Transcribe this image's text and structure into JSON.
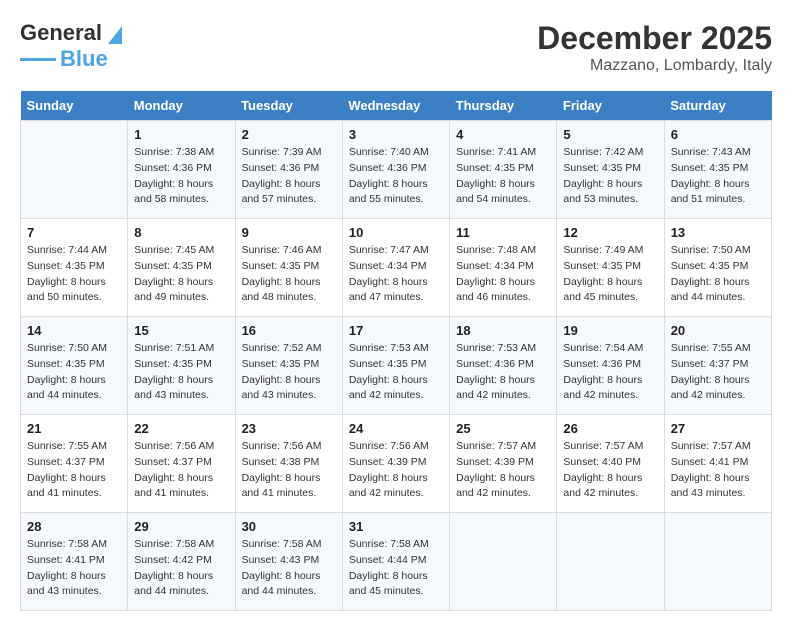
{
  "header": {
    "logo_line1": "General",
    "logo_line2": "Blue",
    "month": "December 2025",
    "location": "Mazzano, Lombardy, Italy"
  },
  "days_of_week": [
    "Sunday",
    "Monday",
    "Tuesday",
    "Wednesday",
    "Thursday",
    "Friday",
    "Saturday"
  ],
  "weeks": [
    [
      {
        "day": "",
        "sunrise": "",
        "sunset": "",
        "daylight": ""
      },
      {
        "day": "1",
        "sunrise": "Sunrise: 7:38 AM",
        "sunset": "Sunset: 4:36 PM",
        "daylight": "Daylight: 8 hours and 58 minutes."
      },
      {
        "day": "2",
        "sunrise": "Sunrise: 7:39 AM",
        "sunset": "Sunset: 4:36 PM",
        "daylight": "Daylight: 8 hours and 57 minutes."
      },
      {
        "day": "3",
        "sunrise": "Sunrise: 7:40 AM",
        "sunset": "Sunset: 4:36 PM",
        "daylight": "Daylight: 8 hours and 55 minutes."
      },
      {
        "day": "4",
        "sunrise": "Sunrise: 7:41 AM",
        "sunset": "Sunset: 4:35 PM",
        "daylight": "Daylight: 8 hours and 54 minutes."
      },
      {
        "day": "5",
        "sunrise": "Sunrise: 7:42 AM",
        "sunset": "Sunset: 4:35 PM",
        "daylight": "Daylight: 8 hours and 53 minutes."
      },
      {
        "day": "6",
        "sunrise": "Sunrise: 7:43 AM",
        "sunset": "Sunset: 4:35 PM",
        "daylight": "Daylight: 8 hours and 51 minutes."
      }
    ],
    [
      {
        "day": "7",
        "sunrise": "Sunrise: 7:44 AM",
        "sunset": "Sunset: 4:35 PM",
        "daylight": "Daylight: 8 hours and 50 minutes."
      },
      {
        "day": "8",
        "sunrise": "Sunrise: 7:45 AM",
        "sunset": "Sunset: 4:35 PM",
        "daylight": "Daylight: 8 hours and 49 minutes."
      },
      {
        "day": "9",
        "sunrise": "Sunrise: 7:46 AM",
        "sunset": "Sunset: 4:35 PM",
        "daylight": "Daylight: 8 hours and 48 minutes."
      },
      {
        "day": "10",
        "sunrise": "Sunrise: 7:47 AM",
        "sunset": "Sunset: 4:34 PM",
        "daylight": "Daylight: 8 hours and 47 minutes."
      },
      {
        "day": "11",
        "sunrise": "Sunrise: 7:48 AM",
        "sunset": "Sunset: 4:34 PM",
        "daylight": "Daylight: 8 hours and 46 minutes."
      },
      {
        "day": "12",
        "sunrise": "Sunrise: 7:49 AM",
        "sunset": "Sunset: 4:35 PM",
        "daylight": "Daylight: 8 hours and 45 minutes."
      },
      {
        "day": "13",
        "sunrise": "Sunrise: 7:50 AM",
        "sunset": "Sunset: 4:35 PM",
        "daylight": "Daylight: 8 hours and 44 minutes."
      }
    ],
    [
      {
        "day": "14",
        "sunrise": "Sunrise: 7:50 AM",
        "sunset": "Sunset: 4:35 PM",
        "daylight": "Daylight: 8 hours and 44 minutes."
      },
      {
        "day": "15",
        "sunrise": "Sunrise: 7:51 AM",
        "sunset": "Sunset: 4:35 PM",
        "daylight": "Daylight: 8 hours and 43 minutes."
      },
      {
        "day": "16",
        "sunrise": "Sunrise: 7:52 AM",
        "sunset": "Sunset: 4:35 PM",
        "daylight": "Daylight: 8 hours and 43 minutes."
      },
      {
        "day": "17",
        "sunrise": "Sunrise: 7:53 AM",
        "sunset": "Sunset: 4:35 PM",
        "daylight": "Daylight: 8 hours and 42 minutes."
      },
      {
        "day": "18",
        "sunrise": "Sunrise: 7:53 AM",
        "sunset": "Sunset: 4:36 PM",
        "daylight": "Daylight: 8 hours and 42 minutes."
      },
      {
        "day": "19",
        "sunrise": "Sunrise: 7:54 AM",
        "sunset": "Sunset: 4:36 PM",
        "daylight": "Daylight: 8 hours and 42 minutes."
      },
      {
        "day": "20",
        "sunrise": "Sunrise: 7:55 AM",
        "sunset": "Sunset: 4:37 PM",
        "daylight": "Daylight: 8 hours and 42 minutes."
      }
    ],
    [
      {
        "day": "21",
        "sunrise": "Sunrise: 7:55 AM",
        "sunset": "Sunset: 4:37 PM",
        "daylight": "Daylight: 8 hours and 41 minutes."
      },
      {
        "day": "22",
        "sunrise": "Sunrise: 7:56 AM",
        "sunset": "Sunset: 4:37 PM",
        "daylight": "Daylight: 8 hours and 41 minutes."
      },
      {
        "day": "23",
        "sunrise": "Sunrise: 7:56 AM",
        "sunset": "Sunset: 4:38 PM",
        "daylight": "Daylight: 8 hours and 41 minutes."
      },
      {
        "day": "24",
        "sunrise": "Sunrise: 7:56 AM",
        "sunset": "Sunset: 4:39 PM",
        "daylight": "Daylight: 8 hours and 42 minutes."
      },
      {
        "day": "25",
        "sunrise": "Sunrise: 7:57 AM",
        "sunset": "Sunset: 4:39 PM",
        "daylight": "Daylight: 8 hours and 42 minutes."
      },
      {
        "day": "26",
        "sunrise": "Sunrise: 7:57 AM",
        "sunset": "Sunset: 4:40 PM",
        "daylight": "Daylight: 8 hours and 42 minutes."
      },
      {
        "day": "27",
        "sunrise": "Sunrise: 7:57 AM",
        "sunset": "Sunset: 4:41 PM",
        "daylight": "Daylight: 8 hours and 43 minutes."
      }
    ],
    [
      {
        "day": "28",
        "sunrise": "Sunrise: 7:58 AM",
        "sunset": "Sunset: 4:41 PM",
        "daylight": "Daylight: 8 hours and 43 minutes."
      },
      {
        "day": "29",
        "sunrise": "Sunrise: 7:58 AM",
        "sunset": "Sunset: 4:42 PM",
        "daylight": "Daylight: 8 hours and 44 minutes."
      },
      {
        "day": "30",
        "sunrise": "Sunrise: 7:58 AM",
        "sunset": "Sunset: 4:43 PM",
        "daylight": "Daylight: 8 hours and 44 minutes."
      },
      {
        "day": "31",
        "sunrise": "Sunrise: 7:58 AM",
        "sunset": "Sunset: 4:44 PM",
        "daylight": "Daylight: 8 hours and 45 minutes."
      },
      {
        "day": "",
        "sunrise": "",
        "sunset": "",
        "daylight": ""
      },
      {
        "day": "",
        "sunrise": "",
        "sunset": "",
        "daylight": ""
      },
      {
        "day": "",
        "sunrise": "",
        "sunset": "",
        "daylight": ""
      }
    ]
  ]
}
